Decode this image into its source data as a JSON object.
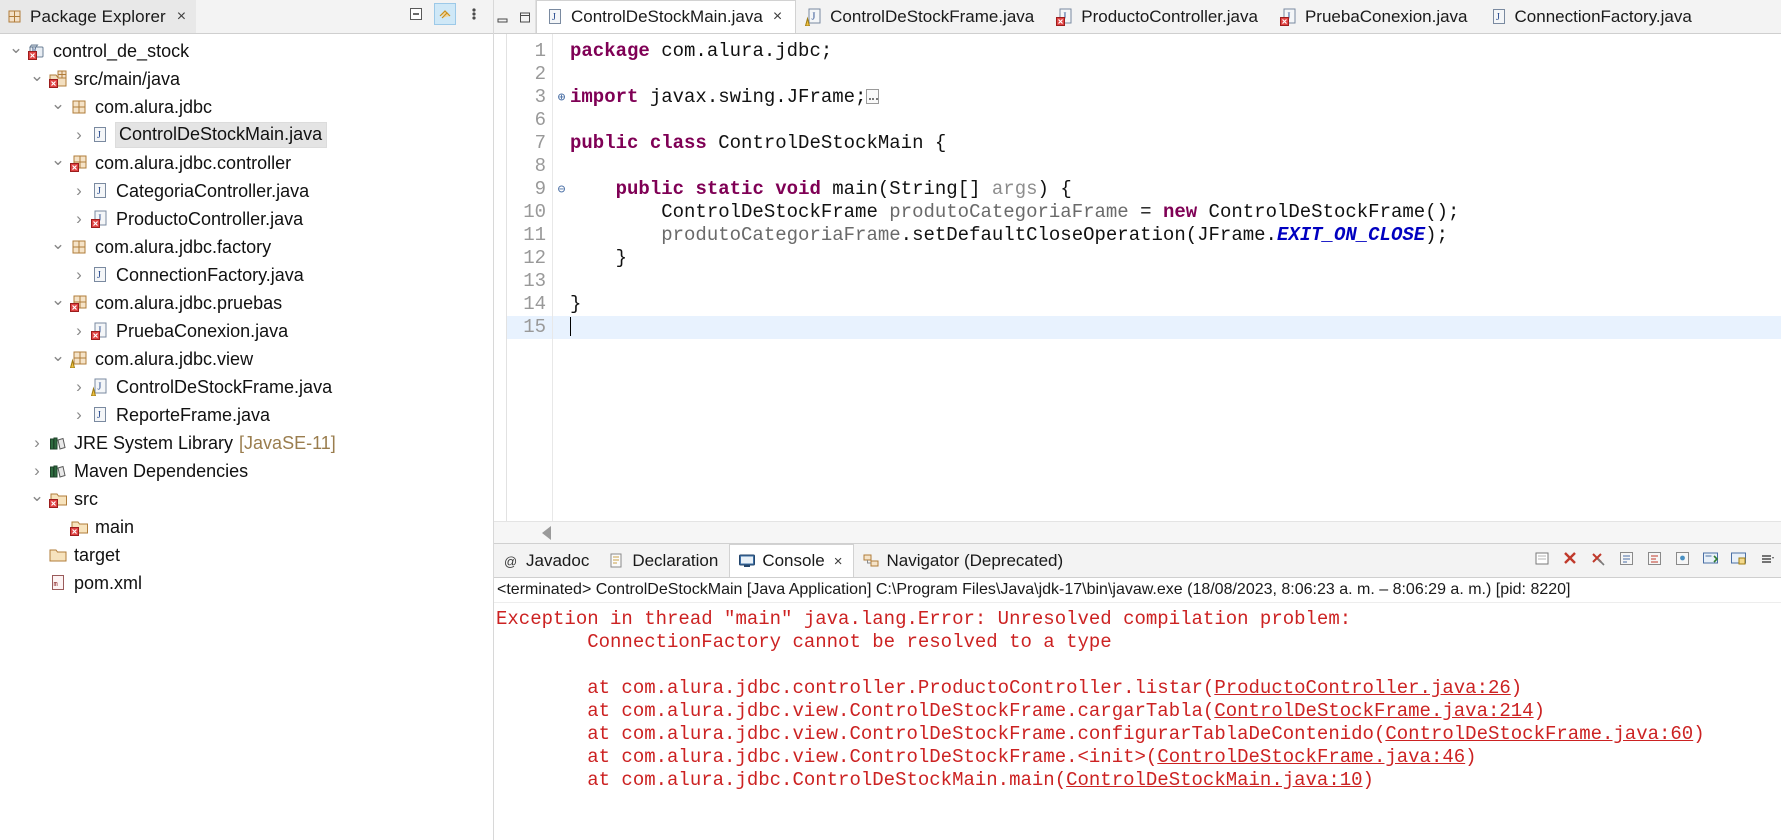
{
  "explorer": {
    "tab_label": "Package Explorer",
    "tab_close": "×",
    "toolbar": [
      {
        "name": "collapse-all-button",
        "glyph": "collapse"
      },
      {
        "name": "link-with-editor-button",
        "glyph": "link"
      },
      {
        "name": "view-menu-button",
        "glyph": "menu"
      }
    ],
    "tree": [
      {
        "label": "control_de_stock",
        "indent": 0,
        "arrow": "down",
        "icon": "maven-project-icon",
        "suffix": "",
        "selected": false
      },
      {
        "label": "src/main/java",
        "indent": 1,
        "arrow": "down",
        "icon": "source-folder-icon",
        "suffix": "",
        "selected": false
      },
      {
        "label": "com.alura.jdbc",
        "indent": 2,
        "arrow": "down",
        "icon": "package-icon",
        "suffix": "",
        "selected": false
      },
      {
        "label": "ControlDeStockMain.java",
        "indent": 3,
        "arrow": "right",
        "icon": "java-file-icon",
        "suffix": "",
        "selected": true
      },
      {
        "label": "com.alura.jdbc.controller",
        "indent": 2,
        "arrow": "down",
        "icon": "package-error-icon",
        "suffix": "",
        "selected": false
      },
      {
        "label": "CategoriaController.java",
        "indent": 3,
        "arrow": "right",
        "icon": "java-file-icon",
        "suffix": "",
        "selected": false
      },
      {
        "label": "ProductoController.java",
        "indent": 3,
        "arrow": "right",
        "icon": "java-file-error-icon",
        "suffix": "",
        "selected": false
      },
      {
        "label": "com.alura.jdbc.factory",
        "indent": 2,
        "arrow": "down",
        "icon": "package-icon",
        "suffix": "",
        "selected": false
      },
      {
        "label": "ConnectionFactory.java",
        "indent": 3,
        "arrow": "right",
        "icon": "java-file-icon",
        "suffix": "",
        "selected": false
      },
      {
        "label": "com.alura.jdbc.pruebas",
        "indent": 2,
        "arrow": "down",
        "icon": "package-error-icon",
        "suffix": "",
        "selected": false
      },
      {
        "label": "PruebaConexion.java",
        "indent": 3,
        "arrow": "right",
        "icon": "java-file-error-icon",
        "suffix": "",
        "selected": false
      },
      {
        "label": "com.alura.jdbc.view",
        "indent": 2,
        "arrow": "down",
        "icon": "package-warn-icon",
        "suffix": "",
        "selected": false
      },
      {
        "label": "ControlDeStockFrame.java",
        "indent": 3,
        "arrow": "right",
        "icon": "java-file-warn-icon",
        "suffix": "",
        "selected": false
      },
      {
        "label": "ReporteFrame.java",
        "indent": 3,
        "arrow": "right",
        "icon": "java-file-icon",
        "suffix": "",
        "selected": false
      },
      {
        "label": "JRE System Library",
        "indent": 1,
        "arrow": "right",
        "icon": "library-icon",
        "suffix": "[JavaSE-11]",
        "selected": false
      },
      {
        "label": "Maven Dependencies",
        "indent": 1,
        "arrow": "right",
        "icon": "library-icon",
        "suffix": "",
        "selected": false
      },
      {
        "label": "src",
        "indent": 1,
        "arrow": "down",
        "icon": "folder-error-icon",
        "suffix": "",
        "selected": false
      },
      {
        "label": "main",
        "indent": 2,
        "arrow": "blank",
        "icon": "folder-error-icon",
        "suffix": "",
        "selected": false
      },
      {
        "label": "target",
        "indent": 1,
        "arrow": "blank",
        "icon": "folder-icon",
        "suffix": "",
        "selected": false
      },
      {
        "label": "pom.xml",
        "indent": 1,
        "arrow": "blank",
        "icon": "xml-file-icon",
        "suffix": "",
        "selected": false
      }
    ]
  },
  "editor": {
    "window_buttons": [
      {
        "name": "minimize-editor-button",
        "glyph": "minimize"
      },
      {
        "name": "maximize-editor-button",
        "glyph": "maximize"
      }
    ],
    "tabs": [
      {
        "label": "ControlDeStockMain.java",
        "icon": "java-file-icon",
        "active": true,
        "close": "×"
      },
      {
        "label": "ControlDeStockFrame.java",
        "icon": "java-file-warn-icon",
        "active": false,
        "close": ""
      },
      {
        "label": "ProductoController.java",
        "icon": "java-file-error-icon",
        "active": false,
        "close": ""
      },
      {
        "label": "PruebaConexion.java",
        "icon": "java-file-error-icon",
        "active": false,
        "close": ""
      },
      {
        "label": "ConnectionFactory.java",
        "icon": "java-file-icon",
        "active": false,
        "close": ""
      }
    ],
    "line_numbers": [
      "1",
      "2",
      "3",
      "6",
      "7",
      "8",
      "9",
      "10",
      "11",
      "12",
      "13",
      "14",
      "15"
    ],
    "fold_markers": [
      "",
      "",
      "⊕",
      "",
      "",
      "",
      "⊖",
      "",
      "",
      "",
      "",
      "",
      ""
    ],
    "code_text": [
      "package com.alura.jdbc;",
      "",
      "import javax.swing.JFrame;",
      "",
      "public class ControlDeStockMain {",
      "",
      "    public static void main(String[] args) {",
      "        ControlDeStockFrame produtoCategoriaFrame = new ControlDeStockFrame();",
      "        produtoCategoriaFrame.setDefaultCloseOperation(JFrame.EXIT_ON_CLOSE);",
      "    }",
      "",
      "}",
      ""
    ],
    "caret_line_index": 12,
    "hscroll_left_arrow": "left-scroll-arrow"
  },
  "console": {
    "tabs": [
      {
        "label": "Javadoc",
        "icon": "javadoc-icon",
        "active": false,
        "close": ""
      },
      {
        "label": "Declaration",
        "icon": "declaration-icon",
        "active": false,
        "close": ""
      },
      {
        "label": "Console",
        "icon": "console-icon",
        "active": true,
        "close": "×"
      },
      {
        "label": "Navigator (Deprecated)",
        "icon": "navigator-icon",
        "active": false,
        "close": ""
      }
    ],
    "toolbar": [
      {
        "name": "clear-console-button",
        "glyph": "clear"
      },
      {
        "name": "terminate-button",
        "glyph": "terminate"
      },
      {
        "name": "remove-all-terminated-button",
        "glyph": "remove-all"
      },
      {
        "name": "scroll-lock-button",
        "glyph": "scroll-lock"
      },
      {
        "name": "word-wrap-button",
        "glyph": "word-wrap"
      },
      {
        "name": "pin-console-button",
        "glyph": "pin"
      },
      {
        "name": "display-selected-console-button",
        "glyph": "display-console"
      },
      {
        "name": "open-console-button",
        "glyph": "open-console"
      },
      {
        "name": "console-view-menu-button",
        "glyph": "menu"
      }
    ],
    "status_line": "<terminated> ControlDeStockMain [Java Application] C:\\Program Files\\Java\\jdk-17\\bin\\javaw.exe  (18/08/2023, 8:06:23 a. m. – 8:06:29 a. m.) [pid: 8220]",
    "output_lines": [
      {
        "text": "Exception in thread \"main\" java.lang.Error: Unresolved compilation problem: ",
        "link": ""
      },
      {
        "text": "\tConnectionFactory cannot be resolved to a type",
        "link": ""
      },
      {
        "text": "",
        "link": ""
      },
      {
        "text": "\tat com.alura.jdbc.controller.ProductoController.listar(",
        "link": "ProductoController.java:26",
        "tail": ")"
      },
      {
        "text": "\tat com.alura.jdbc.view.ControlDeStockFrame.cargarTabla(",
        "link": "ControlDeStockFrame.java:214",
        "tail": ")"
      },
      {
        "text": "\tat com.alura.jdbc.view.ControlDeStockFrame.configurarTablaDeContenido(",
        "link": "ControlDeStockFrame.java:60",
        "tail": ")"
      },
      {
        "text": "\tat com.alura.jdbc.view.ControlDeStockFrame.<init>(",
        "link": "ControlDeStockFrame.java:46",
        "tail": ")"
      },
      {
        "text": "\tat com.alura.jdbc.ControlDeStockMain.main(",
        "link": "ControlDeStockMain.java:10",
        "tail": ")"
      }
    ]
  },
  "colors": {
    "keyword": "#7f0055",
    "static_field": "#0000c0",
    "error_text": "#cc2222",
    "selection": "#e4e4e4",
    "current_line": "#e8f2fe"
  }
}
